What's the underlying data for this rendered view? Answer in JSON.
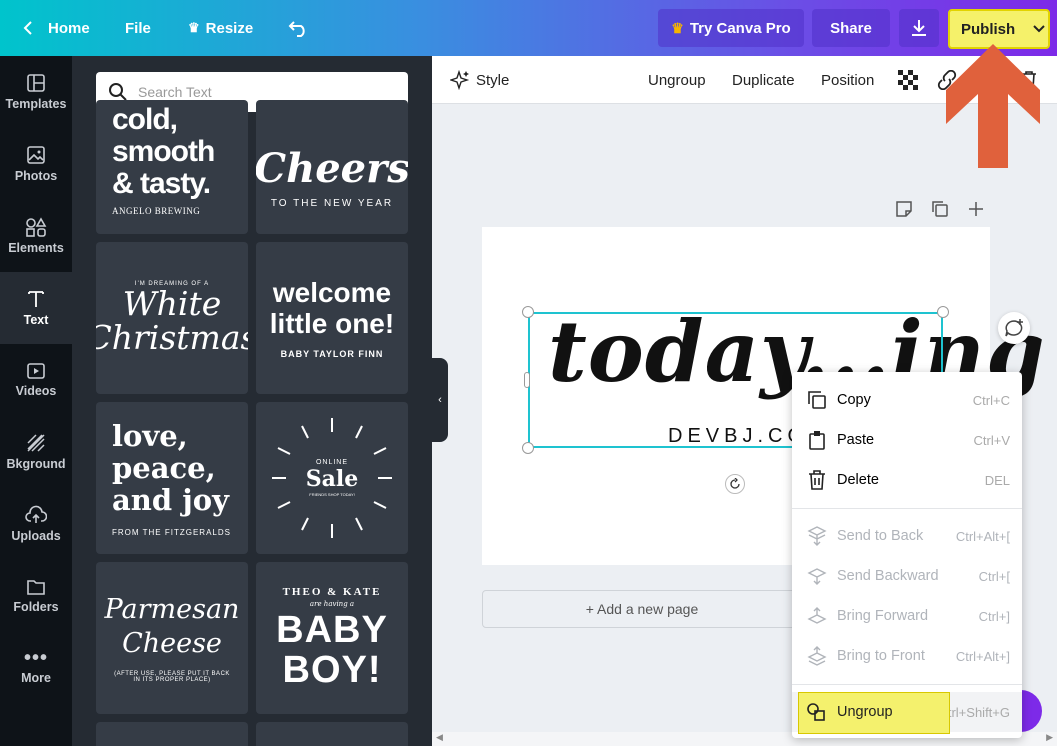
{
  "topbar": {
    "home": "Home",
    "file": "File",
    "resize": "Resize",
    "try_pro": "Try Canva Pro",
    "share": "Share",
    "publish": "Publish"
  },
  "rail": [
    {
      "label": "Templates",
      "icon": "templates-icon"
    },
    {
      "label": "Photos",
      "icon": "photos-icon"
    },
    {
      "label": "Elements",
      "icon": "elements-icon"
    },
    {
      "label": "Text",
      "icon": "text-icon"
    },
    {
      "label": "Videos",
      "icon": "videos-icon"
    },
    {
      "label": "Bkground",
      "icon": "background-icon"
    },
    {
      "label": "Uploads",
      "icon": "uploads-icon"
    },
    {
      "label": "Folders",
      "icon": "folders-icon"
    },
    {
      "label": "More",
      "icon": "more-icon"
    }
  ],
  "search": {
    "placeholder": "Search Text"
  },
  "cards": {
    "c1": {
      "main": "cold,\nsmooth\n& tasty.",
      "sub": "ANGELO BREWING"
    },
    "c2": {
      "main": "Cheers",
      "sub": "TO THE NEW YEAR"
    },
    "c3": {
      "top": "I'M DREAMING OF A",
      "main": "White\nChristmas"
    },
    "c4": {
      "main": "welcome\nlittle one!",
      "sub": "BABY TAYLOR FINN"
    },
    "c5": {
      "main": "love,\npeace,\nand joy",
      "sub": "FROM THE FITZGERALDS"
    },
    "c6": {
      "top": "ONLINE",
      "main": "Sale",
      "sub": "FRIENDS SHOP TODAY!"
    },
    "c7": {
      "main": "Parmesan\nCheese",
      "sub": "(AFTER USE, PLEASE PUT IT BACK\nIN ITS PROPER PLACE)"
    },
    "c8": {
      "top": "THEO & KATE",
      "mid": "are having a",
      "main": "BABY\nBOY!"
    }
  },
  "toolbar": {
    "style": "Style",
    "ungroup": "Ungroup",
    "duplicate": "Duplicate",
    "position": "Position"
  },
  "canvas": {
    "script": "today...ing",
    "subtitle": "DEVBJ.COM",
    "add_page": "+ Add a new page"
  },
  "menu": {
    "items": [
      {
        "label": "Copy",
        "shortcut": "Ctrl+C",
        "disabled": false
      },
      {
        "label": "Paste",
        "shortcut": "Ctrl+V",
        "disabled": false
      },
      {
        "label": "Delete",
        "shortcut": "DEL",
        "disabled": false
      },
      {
        "label": "Send to Back",
        "shortcut": "Ctrl+Alt+[",
        "disabled": true
      },
      {
        "label": "Send Backward",
        "shortcut": "Ctrl+[",
        "disabled": true
      },
      {
        "label": "Bring Forward",
        "shortcut": "Ctrl+]",
        "disabled": true
      },
      {
        "label": "Bring to Front",
        "shortcut": "Ctrl+Alt+]",
        "disabled": true
      },
      {
        "label": "Ungroup",
        "shortcut": "Ctrl+Shift+G",
        "disabled": false
      }
    ]
  },
  "colors": {
    "accent": "#00c4cc",
    "purple": "#7d2ae8",
    "highlight": "#f5f16a",
    "arrow": "#e0613c"
  }
}
